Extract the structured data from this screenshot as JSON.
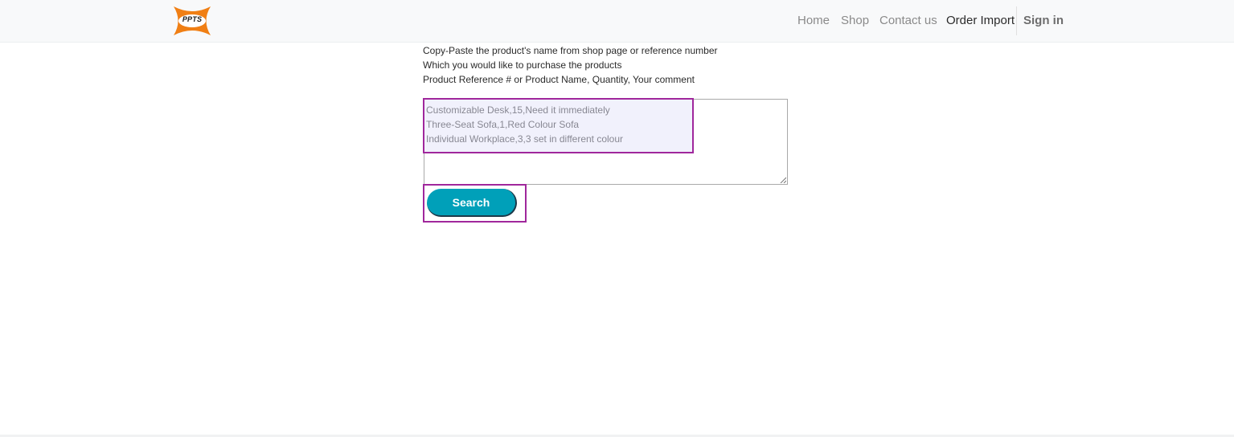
{
  "brand": {
    "logo_text": "PPTS",
    "logo_name": "ppts-logo"
  },
  "nav": {
    "items": [
      {
        "label": "Home",
        "active": false
      },
      {
        "label": "Shop",
        "active": false
      },
      {
        "label": "Contact us",
        "active": false
      },
      {
        "label": "Order Import",
        "active": true
      }
    ],
    "signin_label": "Sign in"
  },
  "instructions": {
    "line1": "Copy-Paste the product's name from shop page or reference number",
    "line2": "Which you would like to purchase the products",
    "line3": "Product Reference # or Product Name, Quantity, Your comment"
  },
  "order_input": {
    "value": "Customizable Desk,15,Need it immediately\nThree-Seat Sofa,1,Red Colour Sofa\nIndividual Workplace,3,3 set in different colour"
  },
  "search_button": {
    "label": "Search"
  },
  "colors": {
    "accent": "#00a0b9",
    "highlight": "#a0279c",
    "logo_orange": "#f07f14"
  }
}
